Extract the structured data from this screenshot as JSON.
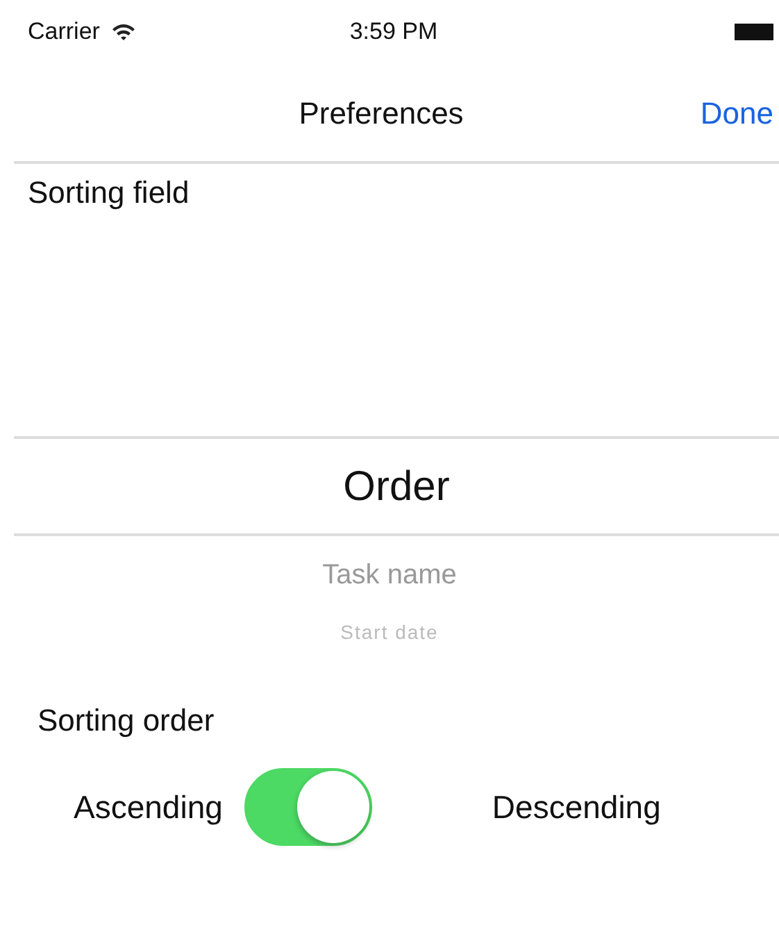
{
  "status_bar": {
    "carrier": "Carrier",
    "time": "3:59 PM"
  },
  "nav_bar": {
    "title": "Preferences",
    "done": "Done"
  },
  "sorting_field": {
    "label": "Sorting field",
    "options": [
      {
        "label": "Order",
        "selected": true
      },
      {
        "label": "Task name",
        "selected": false
      },
      {
        "label": "Start date",
        "selected": false
      }
    ]
  },
  "sorting_order": {
    "label": "Sorting order",
    "left": "Ascending",
    "right": "Descending",
    "on": true
  }
}
